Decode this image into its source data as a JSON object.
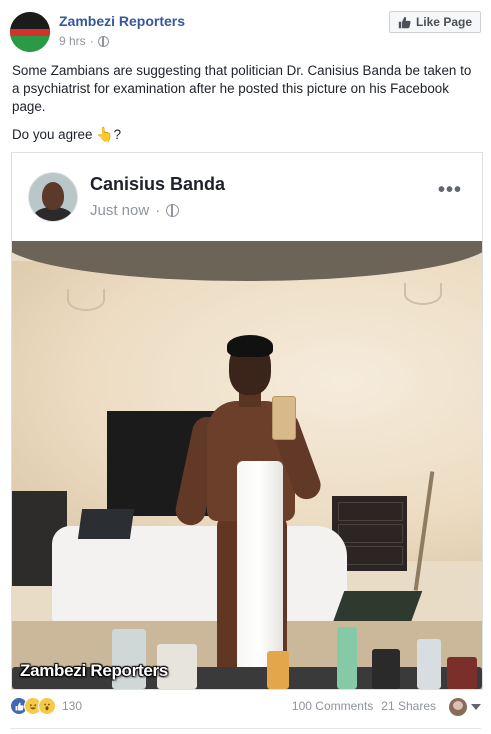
{
  "header": {
    "page_name": "Zambezi Reporters",
    "time": "9 hrs",
    "separator": "·",
    "like_page_label": "Like Page"
  },
  "post": {
    "paragraph1": "Some Zambians are suggesting that politician Dr. Canisius Banda be taken to a psychiatrist for examination after he posted this picture on his Facebook page.",
    "paragraph2_prefix": "Do you agree ",
    "paragraph2_emoji": "👆",
    "paragraph2_suffix": "?"
  },
  "shared_post": {
    "author": "Canisius Banda",
    "time": "Just now",
    "separator": "·",
    "more": "•••"
  },
  "image": {
    "watermark": "Zambezi Reporters"
  },
  "footer": {
    "reaction_count": "130",
    "comments": "100 Comments",
    "shares": "21 Shares"
  },
  "colors": {
    "link_blue": "#365899",
    "like_blue": "#4267b2",
    "meta_gray": "#90949c"
  }
}
